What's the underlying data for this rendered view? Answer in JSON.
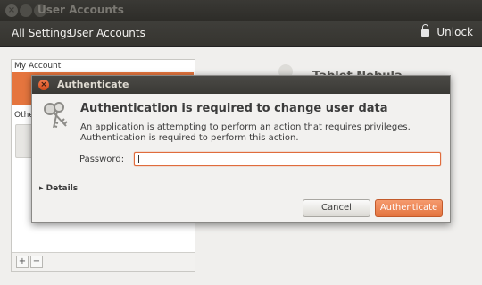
{
  "window": {
    "title": "User Accounts"
  },
  "toolbar": {
    "all_settings": "All Settings",
    "breadcrumb": "User Accounts",
    "unlock_label": "Unlock"
  },
  "accounts_panel": {
    "my_account_label": "My Account",
    "other_label": "Othe"
  },
  "background_user": {
    "name_fragment": "Tablet Nebula"
  },
  "dialog": {
    "title": "Authenticate",
    "headline": "Authentication is required to change user data",
    "line1": "An application is attempting to perform an action that requires privileges.",
    "line2": "Authentication is required to perform this action.",
    "password_label": "Password:",
    "password_value": "",
    "details_label": "Details",
    "cancel_label": "Cancel",
    "authenticate_label": "Authenticate"
  },
  "colors": {
    "accent": "#e4743f",
    "titlebar": "#3c3b37",
    "window_bg": "#f2f1ef"
  },
  "icons": [
    "close-icon",
    "minimize-icon",
    "maximize-icon",
    "lock-icon",
    "keys-icon",
    "expander-arrow-icon",
    "add-icon",
    "remove-icon"
  ]
}
